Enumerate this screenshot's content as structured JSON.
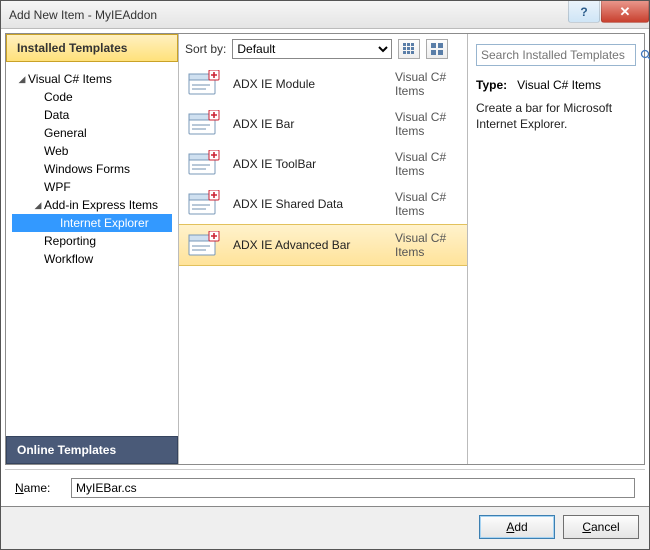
{
  "window": {
    "title": "Add New Item - MyIEAddon"
  },
  "sidebar": {
    "installed_header": "Installed Templates",
    "online_header": "Online Templates",
    "nodes": [
      {
        "label": "Visual C# Items",
        "depth": 0,
        "expanded": true,
        "sel": false
      },
      {
        "label": "Code",
        "depth": 1,
        "sel": false
      },
      {
        "label": "Data",
        "depth": 1,
        "sel": false
      },
      {
        "label": "General",
        "depth": 1,
        "sel": false
      },
      {
        "label": "Web",
        "depth": 1,
        "sel": false
      },
      {
        "label": "Windows Forms",
        "depth": 1,
        "sel": false
      },
      {
        "label": "WPF",
        "depth": 1,
        "sel": false
      },
      {
        "label": "Add-in Express Items",
        "depth": 1,
        "expanded": true,
        "sel": false
      },
      {
        "label": "Internet Explorer",
        "depth": 2,
        "sel": true
      },
      {
        "label": "Reporting",
        "depth": 1,
        "sel": false
      },
      {
        "label": "Workflow",
        "depth": 1,
        "sel": false
      }
    ]
  },
  "toolbar": {
    "sort_label": "Sort by:",
    "sort_value": "Default"
  },
  "items": [
    {
      "name": "ADX IE Module",
      "cat": "Visual C# Items",
      "sel": false
    },
    {
      "name": "ADX IE Bar",
      "cat": "Visual C# Items",
      "sel": false
    },
    {
      "name": "ADX IE ToolBar",
      "cat": "Visual C# Items",
      "sel": false
    },
    {
      "name": "ADX IE Shared Data",
      "cat": "Visual C# Items",
      "sel": false
    },
    {
      "name": "ADX IE Advanced Bar",
      "cat": "Visual C# Items",
      "sel": true
    }
  ],
  "search": {
    "placeholder": "Search Installed Templates"
  },
  "details": {
    "type_label": "Type:",
    "type_value": "Visual C# Items",
    "desc": "Create a bar for Microsoft Internet Explorer."
  },
  "name_field": {
    "label": "Name:",
    "value": "MyIEBar.cs"
  },
  "buttons": {
    "add": "Add",
    "cancel": "Cancel"
  }
}
